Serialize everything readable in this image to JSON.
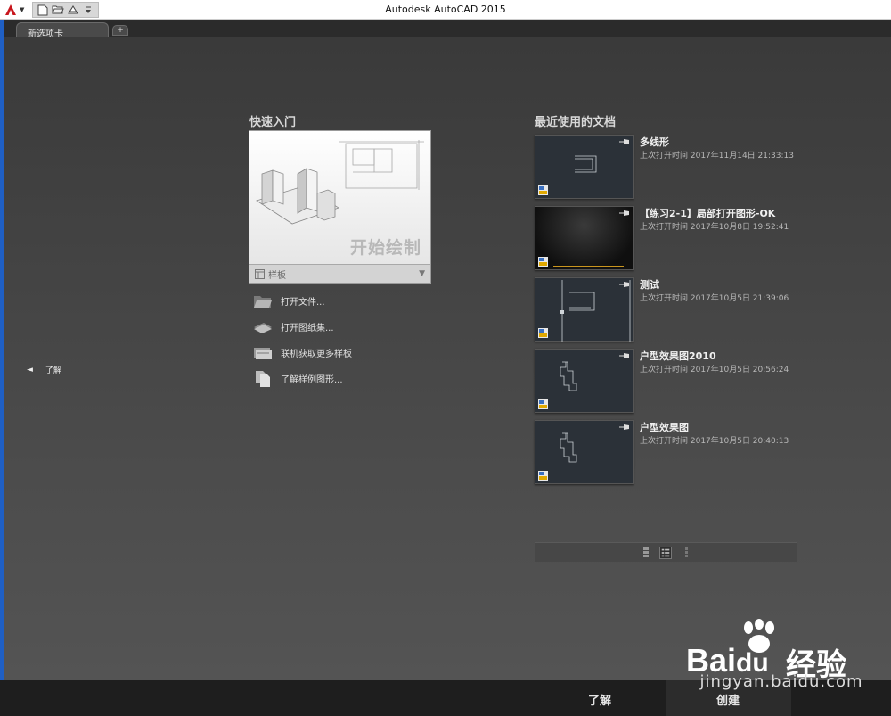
{
  "window": {
    "title": "Autodesk AutoCAD 2015"
  },
  "tabs": {
    "active": "新选项卡",
    "add": "+"
  },
  "side": {
    "arrow": "◄",
    "label": "了解"
  },
  "quickstart": {
    "title": "快速入门",
    "start_label": "开始绘制",
    "template_label": "样板",
    "links": [
      {
        "label": "打开文件...",
        "icon": "folder-icon"
      },
      {
        "label": "打开图纸集...",
        "icon": "sheet-set-icon"
      },
      {
        "label": "联机获取更多样板",
        "icon": "online-templates-icon"
      },
      {
        "label": "了解样例图形...",
        "icon": "sample-drawings-icon"
      }
    ]
  },
  "recent": {
    "title": "最近使用的文档",
    "docs": [
      {
        "name": "多线形",
        "time": "上次打开时间 2017年11月14日 21:33:13"
      },
      {
        "name": "【练习2-1】局部打开图形-OK",
        "time": "上次打开时间 2017年10月8日 19:52:41"
      },
      {
        "name": "测试",
        "time": "上次打开时间 2017年10月5日 21:39:06"
      },
      {
        "name": "户型效果图2010",
        "time": "上次打开时间 2017年10月5日 20:56:24"
      },
      {
        "name": "户型效果图",
        "time": "上次打开时间 2017年10月5日 20:40:13"
      }
    ]
  },
  "bottom": {
    "learn": "了解",
    "create": "创建"
  },
  "watermark": {
    "brand": "Bai",
    "cn": "经验",
    "url": "jingyan.baidu.com"
  }
}
